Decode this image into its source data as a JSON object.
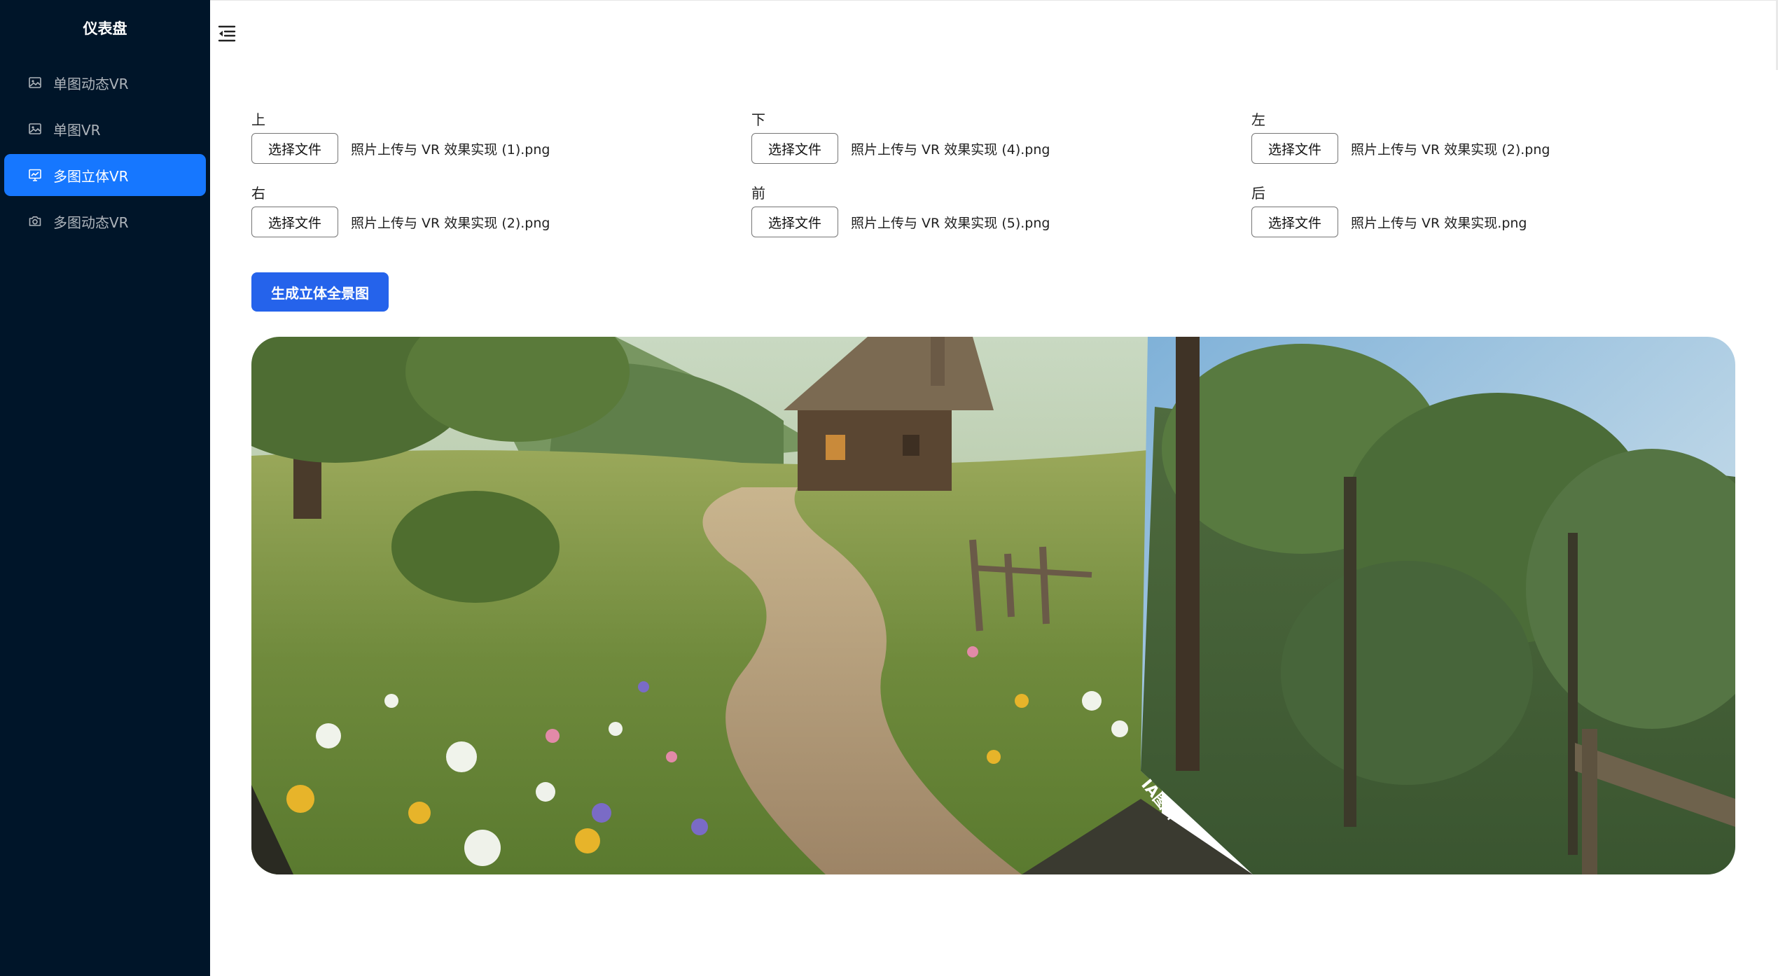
{
  "sidebar": {
    "title": "仪表盘",
    "items": [
      {
        "label": "单图动态VR",
        "icon": "image-icon",
        "active": false
      },
      {
        "label": "单图VR",
        "icon": "image-icon",
        "active": false
      },
      {
        "label": "多图立体VR",
        "icon": "monitor-chart-icon",
        "active": true
      },
      {
        "label": "多图动态VR",
        "icon": "camera-icon",
        "active": false
      }
    ]
  },
  "header": {
    "collapse_icon": "menu-fold-icon"
  },
  "uploads": [
    {
      "label": "上",
      "button": "选择文件",
      "file": "照片上传与 VR 效果实现 (1).png"
    },
    {
      "label": "下",
      "button": "选择文件",
      "file": "照片上传与 VR 效果实现 (4).png"
    },
    {
      "label": "左",
      "button": "选择文件",
      "file": "照片上传与 VR 效果实现 (2).png"
    },
    {
      "label": "右",
      "button": "选择文件",
      "file": "照片上传与 VR 效果实现 (2).png"
    },
    {
      "label": "前",
      "button": "选择文件",
      "file": "照片上传与 VR 效果实现 (5).png"
    },
    {
      "label": "后",
      "button": "选择文件",
      "file": "照片上传与 VR 效果实现.png"
    }
  ],
  "generate_button": "生成立体全景图",
  "viewer": {
    "watermark": "IA图片"
  },
  "colors": {
    "sidebar_bg": "#001529",
    "menu_active": "#1677ff",
    "primary_button": "#2563eb"
  }
}
